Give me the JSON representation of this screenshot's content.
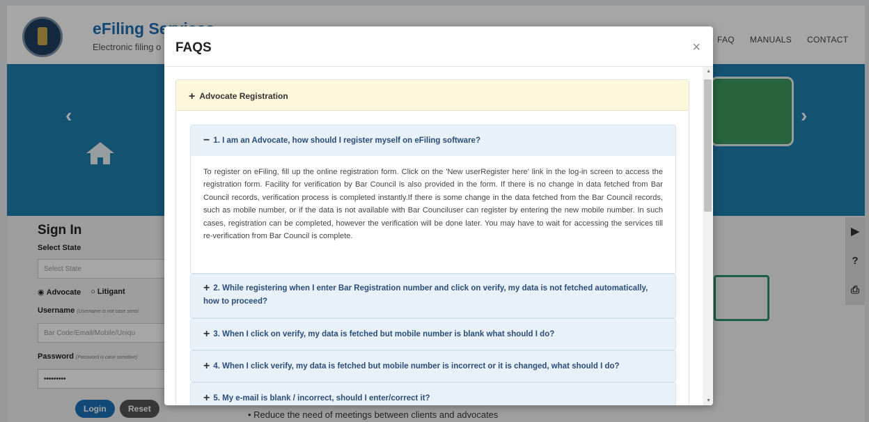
{
  "header": {
    "title": "eFiling Services",
    "subtitle": "Electronic filing o",
    "nav": [
      "FAQ",
      "MANUALS",
      "CONTACT"
    ]
  },
  "signin": {
    "title": "Sign In",
    "state_label": "Select State",
    "state_placeholder": "Select State",
    "radio_advocate": "Advocate",
    "radio_litigant": "Litigant",
    "username_label": "Username",
    "username_hint": "(Username is not case sensi",
    "username_placeholder": "Bar Code/Email/Mobile/Uniqu",
    "password_label": "Password",
    "password_hint": "(Password is case sensitive)",
    "password_value": "•••••••••",
    "login_label": "Login",
    "reset_label": "Reset"
  },
  "background": {
    "bullet": "Reduce the need of meetings between clients and advocates"
  },
  "modal": {
    "title": "FAQS",
    "close": "×",
    "category": {
      "sign": "+",
      "label": "Advocate Registration"
    },
    "faqs": [
      {
        "sign": "−",
        "question": "1. I am an Advocate, how should I register myself on eFiling software?",
        "answer": "To register on eFiling, fill up the online registration form. Click on the 'New userRegister here' link in the log-in screen to access the registration form. Facility for verification by Bar Council is also provided in the form. If there is no change in data fetched from Bar Council records, verification process is completed instantly.If there is some change in the data fetched from the Bar Council records, such as mobile number, or if the data is not available with Bar Counciluser can register by entering the new mobile number. In such cases, registration can be completed, however the verification will be done later. You may have to wait for accessing the services till re-verification from Bar Council is complete."
      },
      {
        "sign": "+",
        "question": "2. While registering when I enter Bar Registration number and click on verify, my data is not fetched automatically, how to proceed?"
      },
      {
        "sign": "+",
        "question": "3. When I click on verify, my data is fetched but mobile number is blank what should I do?"
      },
      {
        "sign": "+",
        "question": "4. When I click verify, my data is fetched but mobile number is incorrect or it is changed, what should I do?"
      },
      {
        "sign": "+",
        "question": "5. My e-mail is blank / incorrect, should I enter/correct it?"
      }
    ]
  },
  "colors": {
    "banner": "#1f7fb0",
    "category_bg": "#fdf7dc",
    "question_bg": "#e8f1f8",
    "question_text": "#2b4d7a"
  }
}
